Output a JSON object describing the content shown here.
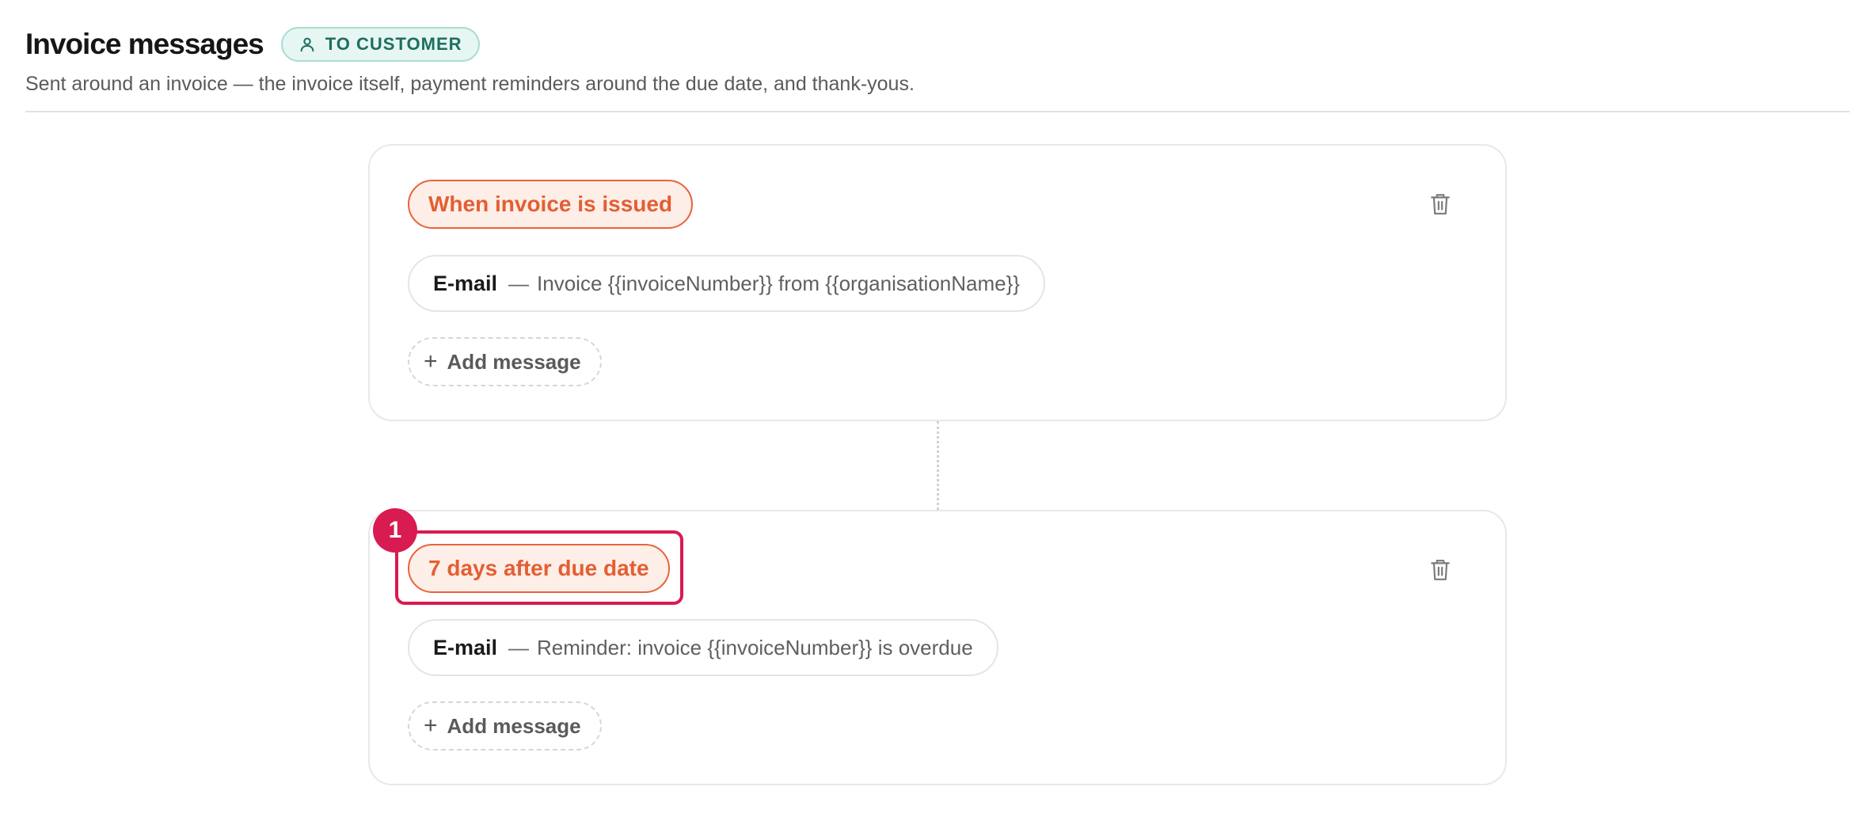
{
  "header": {
    "title": "Invoice messages",
    "badge_label": "TO CUSTOMER",
    "badge_icon": "user-icon",
    "subtitle": "Sent around an invoice — the invoice itself, payment reminders around the due date, and thank-yous."
  },
  "colors": {
    "accent_orange": "#e45e32",
    "highlight": "#d81b50",
    "badge_teal": "#1d6e60"
  },
  "steps": [
    {
      "trigger": "When invoice is issued",
      "messages": [
        {
          "channel": "E-mail",
          "separator": "—",
          "subject": "Invoice {{invoiceNumber}} from {{organisationName}}"
        }
      ],
      "add_label": "Add message",
      "delete_icon": "trash-icon"
    },
    {
      "trigger": "7 days after due date",
      "step_number": "1",
      "messages": [
        {
          "channel": "E-mail",
          "separator": "—",
          "subject": "Reminder: invoice {{invoiceNumber}} is overdue"
        }
      ],
      "add_label": "Add message",
      "delete_icon": "trash-icon"
    }
  ]
}
